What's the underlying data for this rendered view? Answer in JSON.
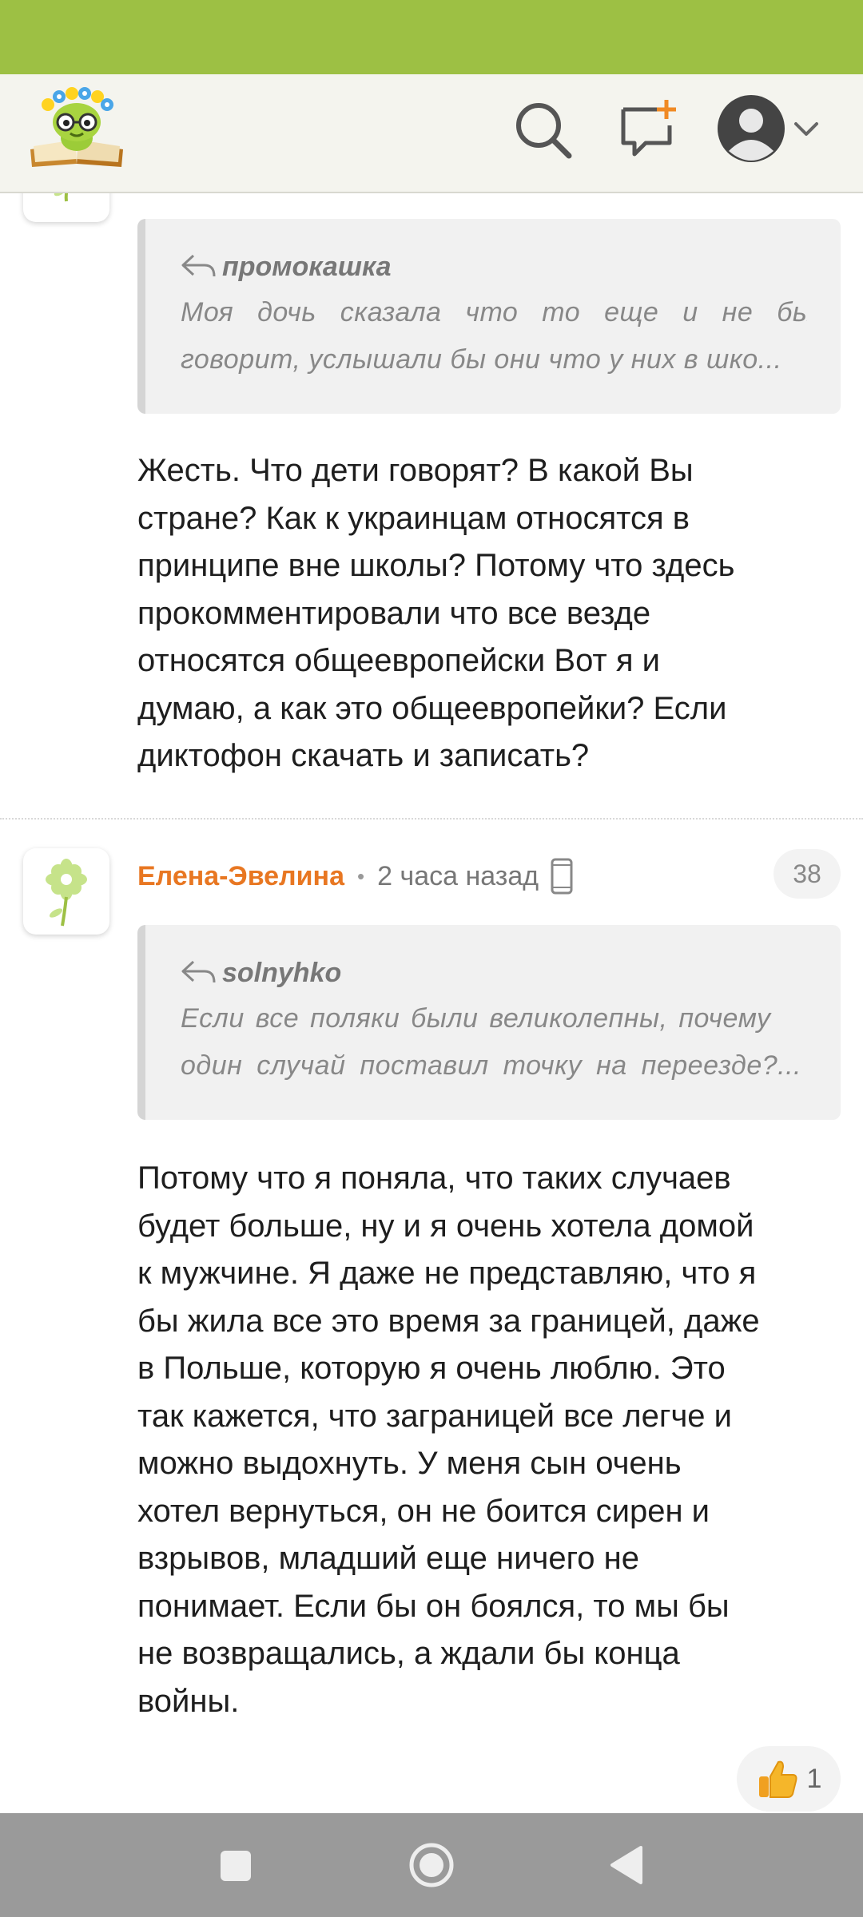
{
  "colors": {
    "status_bar": "#9dc044",
    "author_accent": "#e87722",
    "nav_bar": "#9a9a9a"
  },
  "header": {
    "logo": "site-logo",
    "icons": [
      "search-icon",
      "new-message-icon",
      "user-avatar-icon",
      "chevron-down-icon"
    ]
  },
  "comments": [
    {
      "quote": {
        "author": "промокашка",
        "line1": "Моя дочь сказала что то еще и не были,",
        "line2": "говорит, услышали бы они что у них в шко..."
      },
      "lines": [
        "Жесть. Что дети говорят? В какой Вы",
        "стране? Как к украинцам относятся в",
        "принципе вне школы? Потому что здесь",
        "прокомментировали что все везде",
        "относятся общеевропейски Вот я и",
        "думаю, а как это общеевропейки? Если",
        "диктофон скачать и записать?"
      ]
    },
    {
      "author": "Елена-Эвелина",
      "separator": "•",
      "time": "2 часа назад",
      "count": "38",
      "quote": {
        "author": "solnyhko",
        "line1": "Если все поляки были великолепны, почему",
        "line2": "один случай поставил точку на переезде?..."
      },
      "lines": [
        "Потому что я поняла, что таких случаев",
        "будет больше, ну и я очень хотела домой",
        "к мужчине. Я даже не представляю, что я",
        "бы жила все это время за границей, даже",
        "в Польше, которую я очень люблю. Это",
        "так кажется, что заграницей все легче и",
        "можно выдохнуть. У меня сын очень",
        "хотел вернуться, он не боится сирен и",
        "взрывов, младший еще ничего не",
        "понимает. Если бы он боялся, то мы бы",
        "не возвращались, а ждали бы конца",
        "войны."
      ],
      "likes": "1",
      "like_icon": "thumbs-up-icon"
    }
  ],
  "navbar": {
    "buttons": [
      "recent-apps-button",
      "home-button",
      "back-button"
    ]
  }
}
